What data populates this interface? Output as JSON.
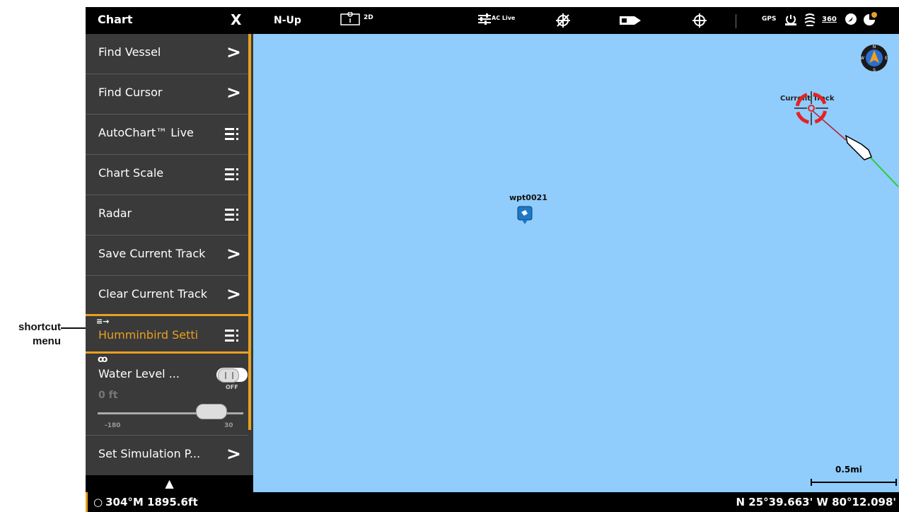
{
  "annotation": {
    "line1": "shortcut",
    "line2": "menu"
  },
  "menu": {
    "title": "Chart",
    "close_icon": "X",
    "items": [
      {
        "label": "Find Vessel",
        "type": "chevron"
      },
      {
        "label": "Find Cursor",
        "type": "chevron"
      },
      {
        "label": "AutoChart™ Live",
        "type": "submenu"
      },
      {
        "label": "Chart Scale",
        "type": "submenu"
      },
      {
        "label": "Radar",
        "type": "submenu"
      },
      {
        "label": "Save Current Track",
        "type": "chevron"
      },
      {
        "label": "Clear Current Track",
        "type": "chevron"
      },
      {
        "label": "Humminbird Setti",
        "type": "submenu",
        "selected": true
      }
    ],
    "water_level": {
      "label": "Water Level ...",
      "toggle": "OFF",
      "value": "0 ft",
      "min": "-180",
      "max": "30",
      "slider_fraction": 0.85
    },
    "last_item": {
      "label": "Set Simulation P...",
      "type": "chevron"
    },
    "chevron": ">",
    "scroll_up": "▲"
  },
  "topbar": {
    "orientation": "N-Up",
    "view_mode": "2D",
    "autochart_label": "AC Live",
    "gps_label": "GPS",
    "sonar_360_label": "360"
  },
  "map": {
    "waypoint_label": "wpt0021",
    "track_label": "Current Track",
    "scale_label": "0.5mi"
  },
  "status": {
    "heading_depth": "304°M 1895.6ft",
    "position": "N 25°39.663' W 80°12.098'"
  },
  "colors": {
    "accent": "#e8a020",
    "map_water": "#90ccfc",
    "menu_bg": "#3a3a3a"
  }
}
